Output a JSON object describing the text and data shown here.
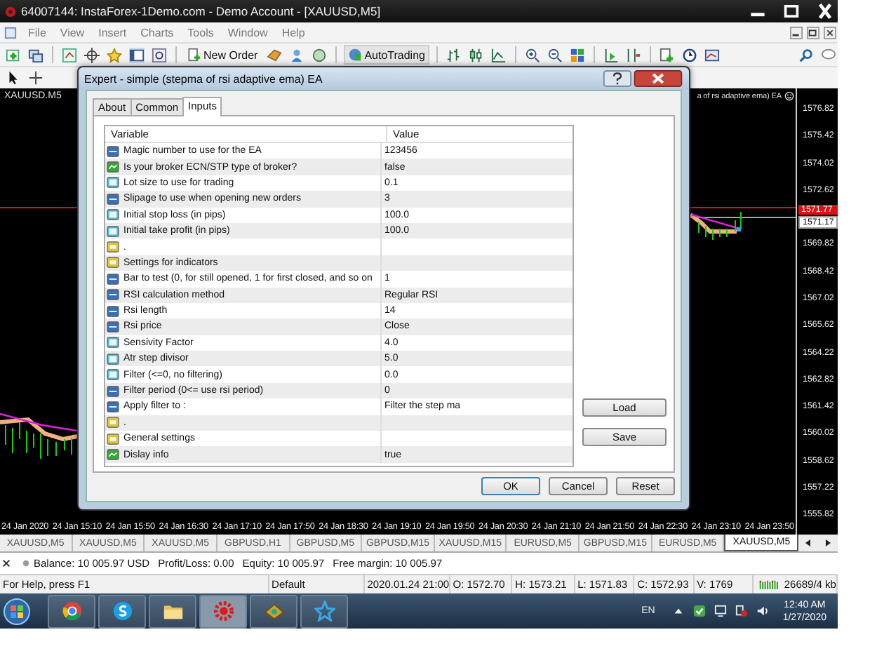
{
  "window": {
    "title": "64007144: InstaForex-1Demo.com - Demo Account - [XAUUSD,M5]"
  },
  "menu": [
    "File",
    "View",
    "Insert",
    "Charts",
    "Tools",
    "Window",
    "Help"
  ],
  "toolbar": {
    "new_order": "New Order",
    "autotrading": "AutoTrading"
  },
  "chart": {
    "symbol": "XAUUSD.M5",
    "expert_label": "a of rsi adaptive ema) EA",
    "price_labels_above": [
      "1576.82",
      "1575.42",
      "1574.02",
      "1572.62"
    ],
    "current_prices": [
      {
        "kind": "ask",
        "text": "1571.77"
      },
      {
        "kind": "bid",
        "text": "1571.17"
      }
    ],
    "price_labels_below": [
      "1569.82",
      "1568.42",
      "1567.02",
      "1565.62",
      "1564.22",
      "1562.82",
      "1561.42",
      "1560.02",
      "1558.62",
      "1557.22",
      "1555.82"
    ],
    "time_labels": [
      "24 Jan 2020",
      "24 Jan 15:10",
      "24 Jan 15:50",
      "24 Jan 16:30",
      "24 Jan 17:10",
      "24 Jan 17:50",
      "24 Jan 18:30",
      "24 Jan 19:10",
      "24 Jan 19:50",
      "24 Jan 20:30",
      "24 Jan 21:10",
      "24 Jan 21:50",
      "24 Jan 22:30",
      "24 Jan 23:10",
      "24 Jan 23:50"
    ]
  },
  "chart_tabs": [
    {
      "label": "XAUUSD,M5",
      "selected": false
    },
    {
      "label": "XAUUSD,M5",
      "selected": false
    },
    {
      "label": "XAUUSD,M5",
      "selected": false
    },
    {
      "label": "GBPUSD,H1",
      "selected": false
    },
    {
      "label": "GBPUSD,M5",
      "selected": false
    },
    {
      "label": "GBPUSD,M15",
      "selected": false
    },
    {
      "label": "XAUUSD,M15",
      "selected": false
    },
    {
      "label": "EURUSD,M5",
      "selected": false
    },
    {
      "label": "GBPUSD,M15",
      "selected": false
    },
    {
      "label": "EURUSD,M5",
      "selected": false
    },
    {
      "label": "XAUUSD,M5",
      "selected": true
    }
  ],
  "balance_bar": [
    "Balance: 10 005.97 USD",
    "Profit/Loss: 0.00",
    "Equity: 10 005.97",
    "Free margin: 10 005.97"
  ],
  "status_bar": {
    "help": "For Help, press F1",
    "profile": "Default",
    "time": "2020.01.24 21:00",
    "open": "O: 1572.70",
    "high": "H: 1573.21",
    "low": "L: 1571.83",
    "close": "C: 1572.93",
    "volume": "V: 1769",
    "memory": "26689/4 kb"
  },
  "taskbar": {
    "language": "EN",
    "time": "12:40 AM",
    "date": "1/27/2020"
  },
  "dialog": {
    "title": "Expert - simple (stepma of rsi adaptive ema) EA",
    "tabs": [
      {
        "label": "About",
        "selected": false
      },
      {
        "label": "Common",
        "selected": false
      },
      {
        "label": "Inputs",
        "selected": true
      }
    ],
    "columns": [
      "Variable",
      "Value"
    ],
    "rows": [
      {
        "kind": "int",
        "variable": "Magic number to use for the EA",
        "value": "123456"
      },
      {
        "kind": "bool",
        "variable": "Is your broker ECN/STP type of broker?",
        "value": "false"
      },
      {
        "kind": "double",
        "variable": "Lot size to use for trading",
        "value": "0.1"
      },
      {
        "kind": "int",
        "variable": "Slipage to use when opening new orders",
        "value": "3"
      },
      {
        "kind": "double",
        "variable": "Initial stop loss (in pips)",
        "value": "100.0"
      },
      {
        "kind": "double",
        "variable": "Initial take profit (in pips)",
        "value": "100.0"
      },
      {
        "kind": "string",
        "variable": "."
      },
      {
        "kind": "string",
        "variable": "Settings for indicators"
      },
      {
        "kind": "int",
        "variable": "Bar to test (0, for still opened, 1 for first closed, and so on",
        "value": "1"
      },
      {
        "kind": "enum",
        "variable": "RSI calculation method",
        "value": "Regular RSI"
      },
      {
        "kind": "int",
        "variable": "Rsi length",
        "value": "14"
      },
      {
        "kind": "enum",
        "variable": "Rsi price",
        "value": "Close"
      },
      {
        "kind": "double",
        "variable": "Sensivity Factor",
        "value": "4.0"
      },
      {
        "kind": "double",
        "variable": "Atr step divisor",
        "value": "5.0"
      },
      {
        "kind": "double",
        "variable": "Filter (<=0, no filtering)",
        "value": "0.0"
      },
      {
        "kind": "int",
        "variable": "Filter period (0<= use rsi period)",
        "value": "0"
      },
      {
        "kind": "enum",
        "variable": "Apply filter to :",
        "value": "Filter the step ma"
      },
      {
        "kind": "string",
        "variable": "."
      },
      {
        "kind": "string",
        "variable": "General settings"
      },
      {
        "kind": "bool",
        "variable": "Dislay info",
        "value": "true"
      }
    ],
    "side_buttons": [
      "Load",
      "Save"
    ],
    "buttons": [
      "OK",
      "Cancel",
      "Reset"
    ]
  }
}
